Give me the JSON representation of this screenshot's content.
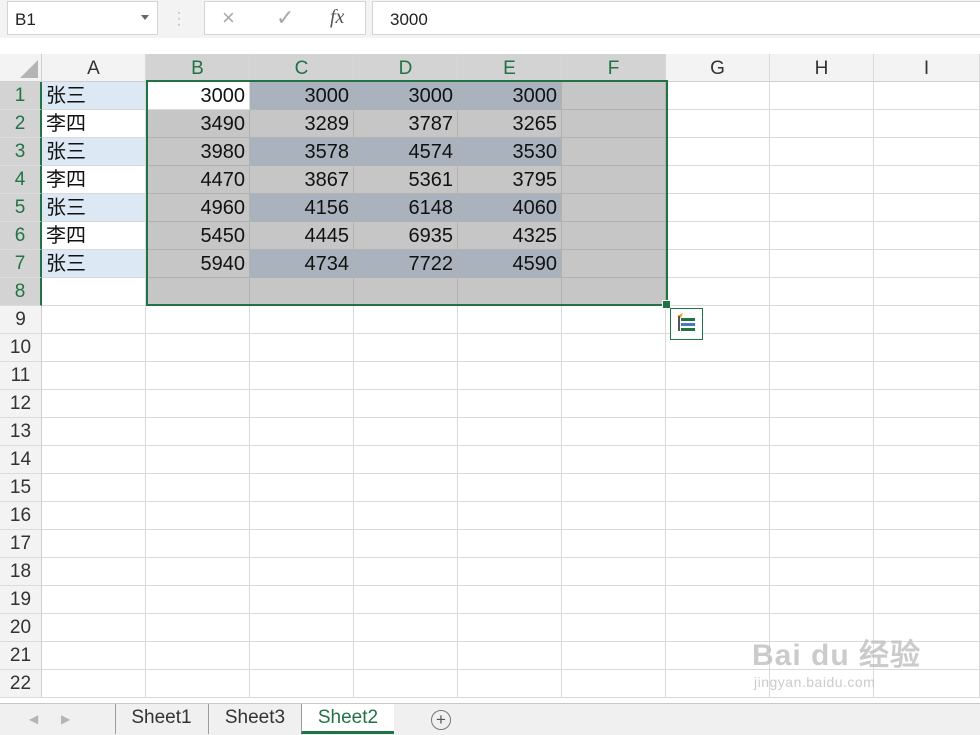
{
  "formula_bar": {
    "name_box": "B1",
    "cancel_icon": "×",
    "enter_icon": "✓",
    "fx_label": "fx",
    "content": "3000"
  },
  "columns": [
    "A",
    "B",
    "C",
    "D",
    "E",
    "F",
    "G",
    "H",
    "I"
  ],
  "selected_columns": [
    "B",
    "C",
    "D",
    "E",
    "F"
  ],
  "rows": [
    "1",
    "2",
    "3",
    "4",
    "5",
    "6",
    "7",
    "8",
    "9",
    "10",
    "11",
    "12",
    "13",
    "14",
    "15",
    "16",
    "17",
    "18",
    "19",
    "20",
    "21",
    "22"
  ],
  "selected_rows": [
    "1",
    "2",
    "3",
    "4",
    "5",
    "6",
    "7",
    "8"
  ],
  "column_a": [
    "张三",
    "李四",
    "张三",
    "李四",
    "张三",
    "李四",
    "张三"
  ],
  "table": [
    [
      "3000",
      "3000",
      "3000",
      "3000"
    ],
    [
      "3490",
      "3289",
      "3787",
      "3265"
    ],
    [
      "3980",
      "3578",
      "4574",
      "3530"
    ],
    [
      "4470",
      "3867",
      "5361",
      "3795"
    ],
    [
      "4960",
      "4156",
      "6148",
      "4060"
    ],
    [
      "5450",
      "4445",
      "6935",
      "4325"
    ],
    [
      "5940",
      "4734",
      "7722",
      "4590"
    ]
  ],
  "selection_range": "B1:F8",
  "active_cell": "B1",
  "sheet_tabs": [
    "Sheet1",
    "Sheet3",
    "Sheet2"
  ],
  "active_sheet": "Sheet2",
  "add_sheet_icon": "+",
  "watermark": {
    "logo": "Bai du 经验",
    "url": "jingyan.baidu.com"
  },
  "colors": {
    "accent": "#217346",
    "selection_grey": "#c6c6c6",
    "selection_slate": "#aab3bd",
    "name_fill": "#dce9f5"
  }
}
